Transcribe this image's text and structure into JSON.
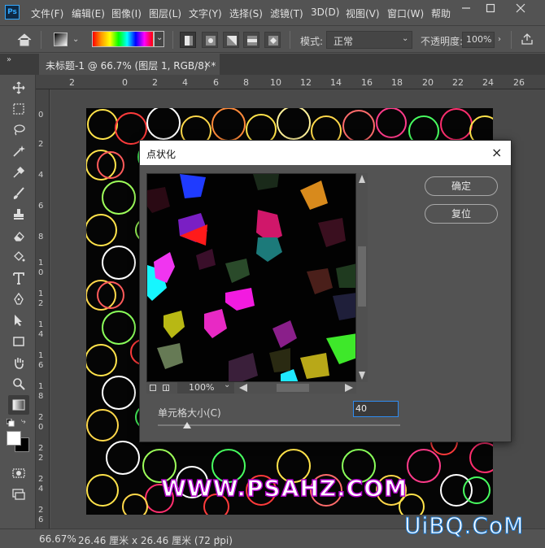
{
  "app": {
    "logo": "Ps"
  },
  "menubar": {
    "items": [
      "文件(F)",
      "编辑(E)",
      "图像(I)",
      "图层(L)",
      "文字(Y)",
      "选择(S)",
      "滤镜(T)",
      "3D(D)",
      "视图(V)",
      "窗口(W)",
      "帮助"
    ]
  },
  "options": {
    "mode_label": "模式:",
    "mode_value": "正常",
    "opacity_label": "不透明度:",
    "opacity_value": "100%"
  },
  "tab": {
    "title": "未标题-1 @ 66.7% (图层 1, RGB/8) *",
    "close": "×"
  },
  "ruler": {
    "top_ticks": [
      "2",
      "0",
      "2",
      "4",
      "6",
      "8",
      "10",
      "12",
      "14",
      "16",
      "18",
      "20",
      "22",
      "24",
      "26"
    ],
    "left_ticks": [
      "0",
      "2",
      "4",
      "6",
      "8",
      "1\n0",
      "1\n2",
      "1\n4",
      "1\n6",
      "1\n8",
      "2\n0",
      "2\n2",
      "2\n4",
      "2\n6"
    ]
  },
  "canvas": {
    "watermark": "WWW.PSAHZ.COM"
  },
  "dialog": {
    "title": "点状化",
    "close": "×",
    "ok_label": "确定",
    "reset_label": "复位",
    "zoom_value": "100%",
    "cell_size_label": "单元格大小(C)",
    "cell_size_value": "40",
    "slider_fraction": 0.12
  },
  "status": {
    "zoom": "66.67%",
    "doc_info": "26.46 厘米 x 26.46 厘米 (72 ppi)"
  },
  "overlay_watermark": "UiBQ.CoM",
  "colors": {
    "accent_blue": "#2f8cf0",
    "panel": "#535353",
    "dark": "#3c3c3c"
  }
}
